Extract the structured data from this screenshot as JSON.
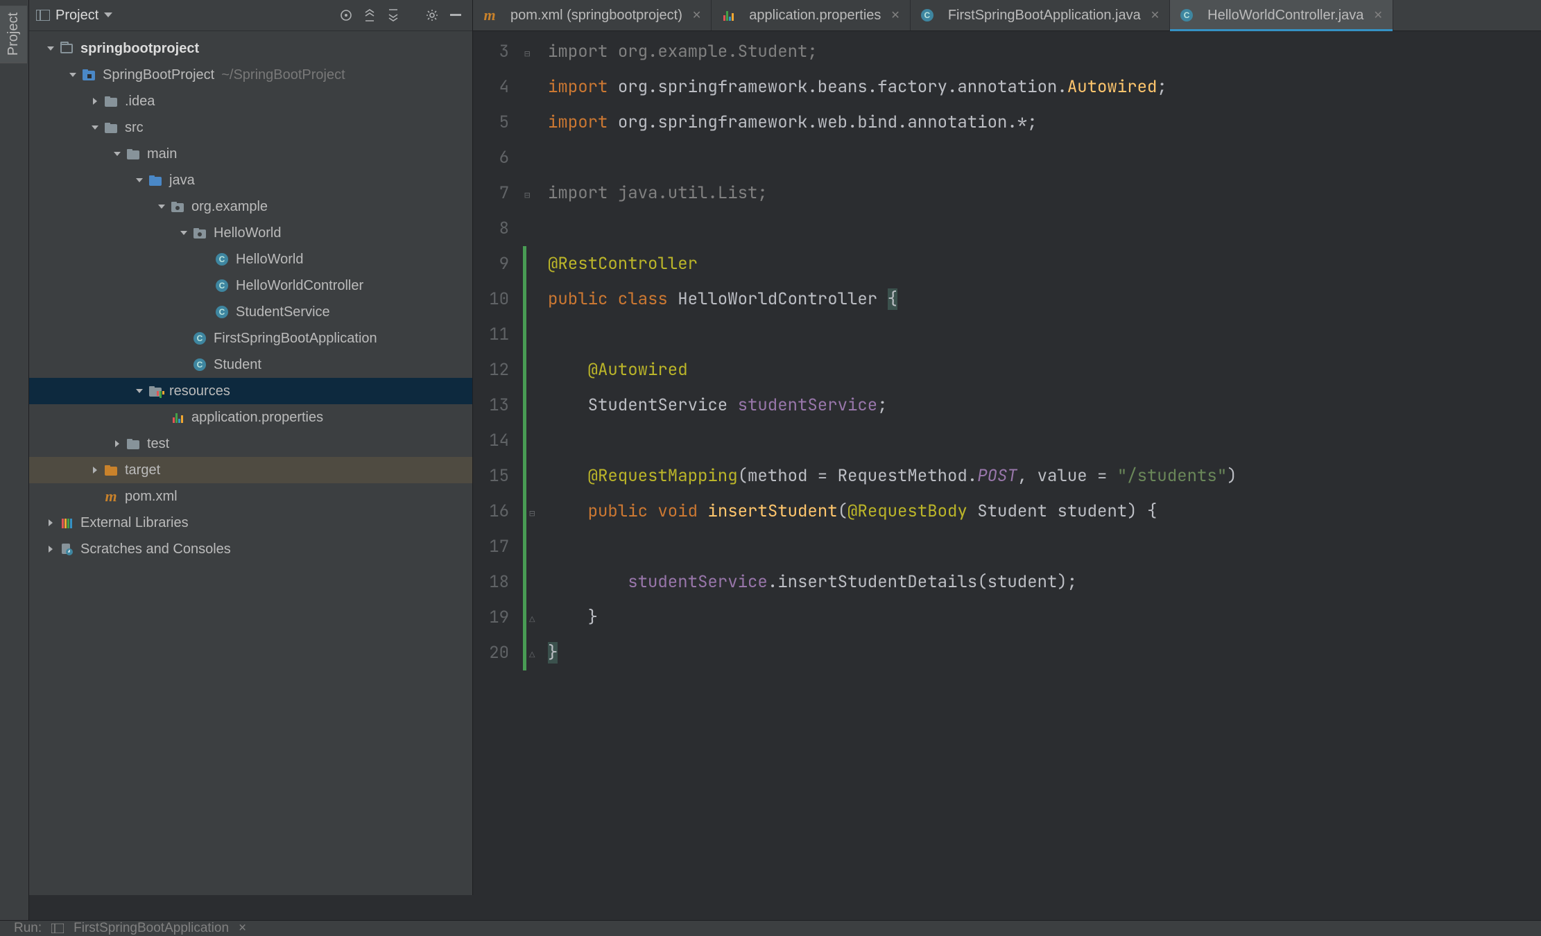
{
  "toolstrip": {
    "project_tab": "Project"
  },
  "sidebar": {
    "title": "Project",
    "tree": [
      {
        "depth": 0,
        "arrow": "down",
        "icon": "project",
        "label": "springbootproject",
        "bold": true
      },
      {
        "depth": 1,
        "arrow": "down",
        "icon": "module",
        "label": "SpringBootProject",
        "hint": "~/SpringBootProject"
      },
      {
        "depth": 2,
        "arrow": "right",
        "icon": "folder",
        "label": ".idea"
      },
      {
        "depth": 2,
        "arrow": "down",
        "icon": "folder",
        "label": "src"
      },
      {
        "depth": 3,
        "arrow": "down",
        "icon": "folder",
        "label": "main"
      },
      {
        "depth": 4,
        "arrow": "down",
        "icon": "folder-blue",
        "label": "java"
      },
      {
        "depth": 5,
        "arrow": "down",
        "icon": "package",
        "label": "org.example"
      },
      {
        "depth": 6,
        "arrow": "down",
        "icon": "package",
        "label": "HelloWorld"
      },
      {
        "depth": 7,
        "arrow": "",
        "icon": "class",
        "label": "HelloWorld"
      },
      {
        "depth": 7,
        "arrow": "",
        "icon": "class",
        "label": "HelloWorldController"
      },
      {
        "depth": 7,
        "arrow": "",
        "icon": "class",
        "label": "StudentService"
      },
      {
        "depth": 6,
        "arrow": "",
        "icon": "class",
        "label": "FirstSpringBootApplication"
      },
      {
        "depth": 6,
        "arrow": "",
        "icon": "class",
        "label": "Student"
      },
      {
        "depth": 4,
        "arrow": "down",
        "icon": "resources",
        "label": "resources",
        "selected": true
      },
      {
        "depth": 5,
        "arrow": "",
        "icon": "props",
        "label": "application.properties"
      },
      {
        "depth": 3,
        "arrow": "right",
        "icon": "folder",
        "label": "test"
      },
      {
        "depth": 2,
        "arrow": "right",
        "icon": "folder-orange",
        "label": "target",
        "highlight": true
      },
      {
        "depth": 2,
        "arrow": "",
        "icon": "maven",
        "label": "pom.xml"
      },
      {
        "depth": 0,
        "arrow": "right",
        "icon": "libs",
        "label": "External Libraries"
      },
      {
        "depth": 0,
        "arrow": "right",
        "icon": "scratch",
        "label": "Scratches and Consoles"
      }
    ]
  },
  "tabs": [
    {
      "icon": "maven",
      "label": "pom.xml (springbootproject)",
      "active": false
    },
    {
      "icon": "props",
      "label": "application.properties",
      "active": false
    },
    {
      "icon": "class",
      "label": "FirstSpringBootApplication.java",
      "active": false
    },
    {
      "icon": "class",
      "label": "HelloWorldController.java",
      "active": true
    }
  ],
  "editor": {
    "first_line_number": 3,
    "lines": [
      {
        "changed": false,
        "marker": "⊟",
        "tokens": [
          [
            "muted-imp",
            "import "
          ],
          [
            "muted-imp",
            "org.example.Student;"
          ]
        ]
      },
      {
        "changed": false,
        "tokens": [
          [
            "kw",
            "import "
          ],
          [
            "type",
            "org.springframework.beans.factory.annotation."
          ],
          [
            "fn",
            "Autowired"
          ],
          [
            "type",
            ";"
          ]
        ]
      },
      {
        "changed": false,
        "tokens": [
          [
            "kw",
            "import "
          ],
          [
            "type",
            "org.springframework.web.bind.annotation.*;"
          ]
        ]
      },
      {
        "changed": false,
        "tokens": [
          [
            "type",
            ""
          ]
        ]
      },
      {
        "changed": false,
        "marker": "⊟",
        "tokens": [
          [
            "muted-imp",
            "import java.util.List;"
          ]
        ]
      },
      {
        "changed": false,
        "tokens": [
          [
            "type",
            ""
          ]
        ]
      },
      {
        "changed": true,
        "tokens": [
          [
            "ann",
            "@RestController"
          ]
        ]
      },
      {
        "changed": true,
        "tokens": [
          [
            "kw",
            "public class "
          ],
          [
            "type",
            "HelloWorldController "
          ],
          [
            "brace-hl",
            "{"
          ]
        ]
      },
      {
        "changed": true,
        "tokens": [
          [
            "type",
            ""
          ]
        ]
      },
      {
        "changed": true,
        "tokens": [
          [
            "type",
            "    "
          ],
          [
            "ann",
            "@Autowired"
          ]
        ]
      },
      {
        "changed": true,
        "tokens": [
          [
            "type",
            "    StudentService "
          ],
          [
            "field",
            "studentService"
          ],
          [
            "type",
            ";"
          ]
        ]
      },
      {
        "changed": true,
        "tokens": [
          [
            "type",
            ""
          ]
        ]
      },
      {
        "changed": true,
        "tokens": [
          [
            "type",
            "    "
          ],
          [
            "ann",
            "@RequestMapping"
          ],
          [
            "type",
            "(method = RequestMethod."
          ],
          [
            "const-it",
            "POST"
          ],
          [
            "type",
            ", value = "
          ],
          [
            "str",
            "\"/students\""
          ],
          [
            "type",
            ")"
          ]
        ]
      },
      {
        "changed": true,
        "marker": "⊟",
        "tokens": [
          [
            "type",
            "    "
          ],
          [
            "kw",
            "public void "
          ],
          [
            "fn",
            "insertStudent"
          ],
          [
            "type",
            "("
          ],
          [
            "ann",
            "@RequestBody"
          ],
          [
            "type",
            " Student student) {"
          ]
        ]
      },
      {
        "changed": true,
        "tokens": [
          [
            "type",
            ""
          ]
        ]
      },
      {
        "changed": true,
        "tokens": [
          [
            "type",
            "        "
          ],
          [
            "field",
            "studentService"
          ],
          [
            "type",
            ".insertStudentDetails(student);"
          ]
        ]
      },
      {
        "changed": true,
        "marker": "△",
        "tokens": [
          [
            "type",
            "    }"
          ]
        ]
      },
      {
        "changed": true,
        "marker": "△",
        "tokens": [
          [
            "brace-hl",
            "}"
          ]
        ]
      }
    ]
  },
  "bottom": {
    "run_label": "Run:",
    "config": "FirstSpringBootApplication"
  }
}
